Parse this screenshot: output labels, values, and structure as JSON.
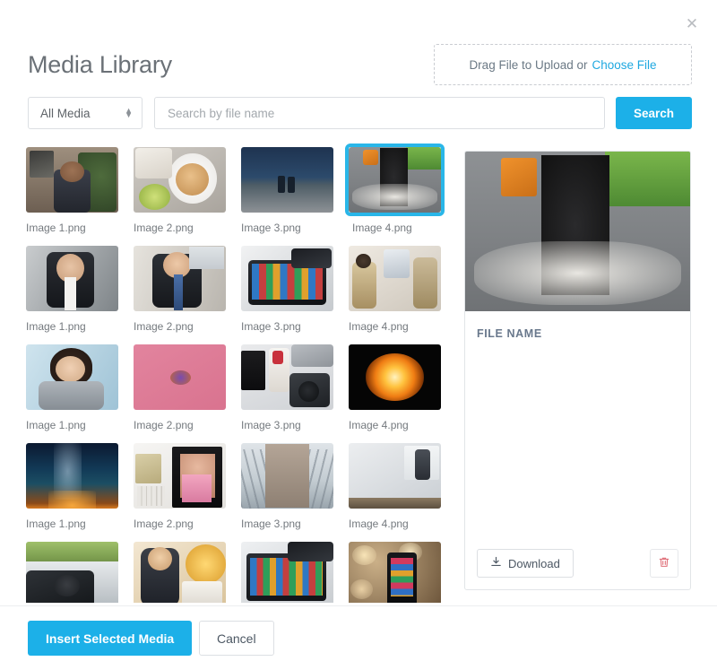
{
  "window": {
    "close_icon": "close-icon"
  },
  "header": {
    "title": "Media Library",
    "dropzone_text": "Drag File to Upload or",
    "dropzone_link": "Choose File"
  },
  "filterbar": {
    "media_filter_value": "All Media",
    "media_filter_options": [
      "All Media"
    ],
    "search_placeholder": "Search by file name",
    "search_value": "",
    "search_button": "Search"
  },
  "colors": {
    "accent": "#1cb0e8",
    "selected_border": "#29b6e8",
    "link": "#1fa8e0",
    "danger": "#e0707a",
    "title_text": "#6b7177",
    "label_text": "#74797e"
  },
  "grid": {
    "rows": [
      {
        "items": [
          {
            "label": "Image 1.png",
            "art": "man-plaid-cafe",
            "selected": false
          },
          {
            "label": "Image 2.png",
            "art": "latte-overhead",
            "selected": false
          },
          {
            "label": "Image 3.png",
            "art": "dusk-beach-couple",
            "selected": false
          },
          {
            "label": "Image 4.png",
            "art": "bike-lane",
            "selected": true
          }
        ]
      },
      {
        "items": [
          {
            "label": "Image 1.png",
            "art": "man-suit-smiling",
            "selected": false
          },
          {
            "label": "Image 2.png",
            "art": "businessman-tie",
            "selected": false
          },
          {
            "label": "Image 3.png",
            "art": "tablet-streaming",
            "selected": false
          },
          {
            "label": "Image 4.png",
            "art": "two-women-meeting",
            "selected": false
          }
        ]
      },
      {
        "items": [
          {
            "label": "Image 1.png",
            "art": "woman-portrait-blue",
            "selected": false
          },
          {
            "label": "Image 2.png",
            "art": "pink-flatlay",
            "selected": false
          },
          {
            "label": "Image 3.png",
            "art": "camera-desk-flatlay",
            "selected": false
          },
          {
            "label": "Image 4.png",
            "art": "orange-firework-flower",
            "selected": false
          }
        ]
      },
      {
        "items": [
          {
            "label": "Image 1.png",
            "art": "milky-way-night",
            "selected": false
          },
          {
            "label": "Image 2.png",
            "art": "magazine-desk",
            "selected": false
          },
          {
            "label": "Image 3.png",
            "art": "brooklyn-bridge",
            "selected": false
          },
          {
            "label": "Image 4.png",
            "art": "office-presentation",
            "selected": false
          }
        ]
      },
      {
        "items": [
          {
            "label": "",
            "art": "car-driver",
            "selected": false
          },
          {
            "label": "",
            "art": "woman-glasses-laptop",
            "selected": false
          },
          {
            "label": "",
            "art": "laptop-streaming",
            "selected": false
          },
          {
            "label": "",
            "art": "phone-bokeh",
            "selected": false
          }
        ]
      }
    ]
  },
  "preview": {
    "art": "bike-lane",
    "filename_label": "FILE NAME",
    "download_label": "Download",
    "download_icon": "download-icon",
    "delete_icon": "trash-icon"
  },
  "footer": {
    "insert_label": "Insert Selected Media",
    "cancel_label": "Cancel"
  }
}
